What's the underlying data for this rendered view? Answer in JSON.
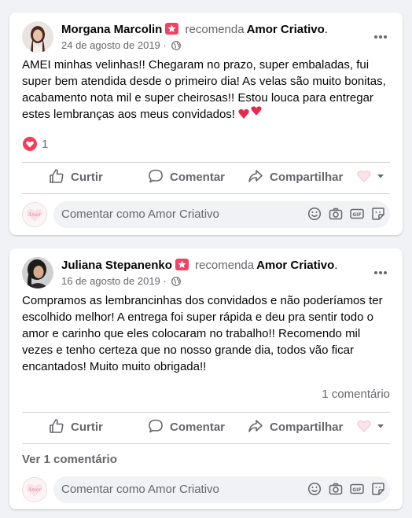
{
  "posts": [
    {
      "author": "Morgana Marcolin",
      "recommends_word": "recomenda",
      "page": "Amor Criativo",
      "page_suffix": ".",
      "date": "24 de agosto de 2019 ·",
      "text": "AMEI minhas velinhas!! Chegaram no prazo, super embaladas, fui\nsuper bem atendida desde o primeiro dia! As velas são muito bonitas,\nacabamento nota mil e super cheirosas!! Estou louca para entregar\nestes lembranças aos meus convidados!",
      "reaction_count": "1",
      "comment_count": ""
    },
    {
      "author": "Juliana Stepanenko",
      "recommends_word": "recomenda",
      "page": "Amor Criativo",
      "page_suffix": ".",
      "date": "16 de agosto de 2019 ·",
      "text": "Compramos as lembrancinhas dos convidados e não poderíamos ter\nescolhido melhor! A entrega foi super rápida e deu pra sentir todo o\namor e carinho que eles colocaram no trabalho!! Recomendo mil\nvezes e tenho certeza que no nosso grande dia, todos vão ficar\nencantados! Muito muito obrigada!!",
      "reaction_count": "",
      "comment_count": "1 comentário",
      "view_comments": "Ver 1 comentário"
    }
  ],
  "actions": {
    "like": "Curtir",
    "comment": "Comentar",
    "share": "Compartilhar"
  },
  "composer": {
    "placeholder": "Comentar como Amor Criativo",
    "avatar_text": "Amor"
  },
  "colors": {
    "background": "#f0f2f5",
    "card": "#ffffff",
    "secondary_text": "#65676b",
    "recommend_badge": "#f3425f",
    "love_reaction": "#f33e58"
  }
}
